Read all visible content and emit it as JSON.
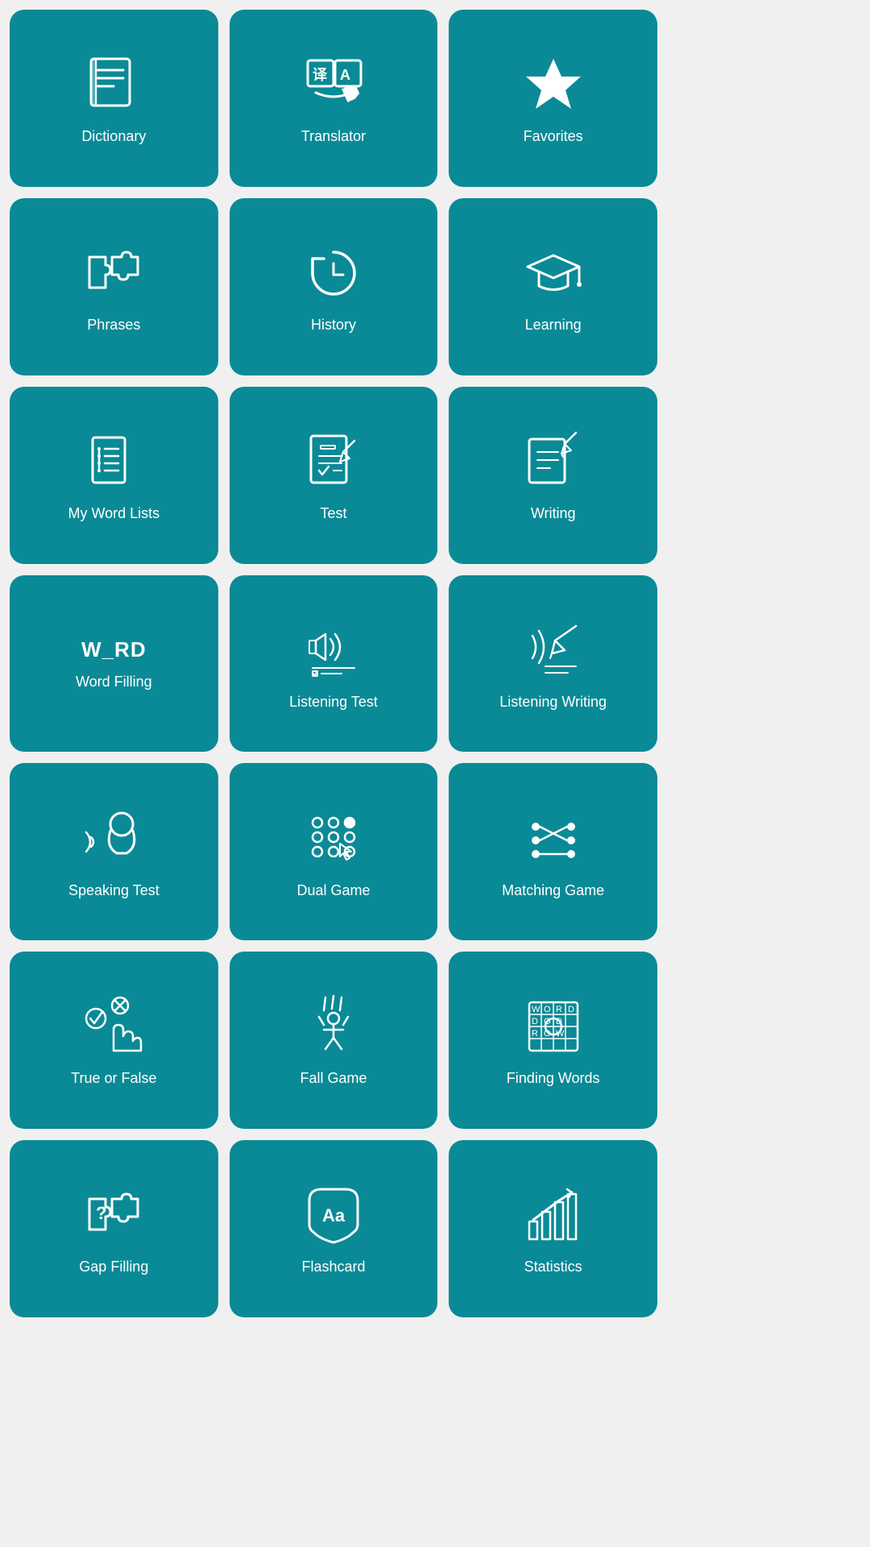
{
  "tiles": [
    {
      "id": "dictionary",
      "label": "Dictionary",
      "icon": "dictionary"
    },
    {
      "id": "translator",
      "label": "Translator",
      "icon": "translator"
    },
    {
      "id": "favorites",
      "label": "Favorites",
      "icon": "favorites"
    },
    {
      "id": "phrases",
      "label": "Phrases",
      "icon": "phrases"
    },
    {
      "id": "history",
      "label": "History",
      "icon": "history"
    },
    {
      "id": "learning",
      "label": "Learning",
      "icon": "learning"
    },
    {
      "id": "my-word-lists",
      "label": "My Word Lists",
      "icon": "wordlists"
    },
    {
      "id": "test",
      "label": "Test",
      "icon": "test"
    },
    {
      "id": "writing",
      "label": "Writing",
      "icon": "writing"
    },
    {
      "id": "word-filling",
      "label": "Word Filling",
      "icon": "wordfilling"
    },
    {
      "id": "listening-test",
      "label": "Listening Test",
      "icon": "listeningtest"
    },
    {
      "id": "listening-writing",
      "label": "Listening Writing",
      "icon": "listeningwriting"
    },
    {
      "id": "speaking-test",
      "label": "Speaking Test",
      "icon": "speakingtest"
    },
    {
      "id": "dual-game",
      "label": "Dual Game",
      "icon": "dualgame"
    },
    {
      "id": "matching-game",
      "label": "Matching Game",
      "icon": "matchinggame"
    },
    {
      "id": "true-or-false",
      "label": "True or False",
      "icon": "trueorfalse"
    },
    {
      "id": "fall-game",
      "label": "Fall Game",
      "icon": "fallgame"
    },
    {
      "id": "finding-words",
      "label": "Finding Words",
      "icon": "findingwords"
    },
    {
      "id": "gap-filling",
      "label": "Gap Filling",
      "icon": "gapfilling"
    },
    {
      "id": "flashcard",
      "label": "Flashcard",
      "icon": "flashcard"
    },
    {
      "id": "statistics",
      "label": "Statistics",
      "icon": "statistics"
    }
  ]
}
